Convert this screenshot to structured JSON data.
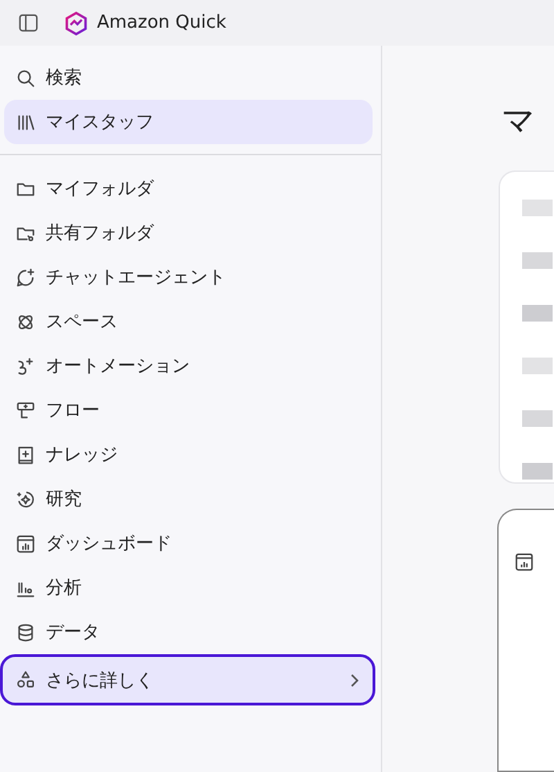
{
  "app": {
    "title": "Amazon Quick"
  },
  "sidebar": {
    "top_items": [
      {
        "label": "検索",
        "selected": false
      },
      {
        "label": "マイスタッフ",
        "selected": true
      }
    ],
    "items": [
      {
        "label": "マイフォルダ",
        "selected": false
      },
      {
        "label": "共有フォルダ",
        "selected": false
      },
      {
        "label": "チャットエージェント",
        "selected": false
      },
      {
        "label": "スペース",
        "selected": false
      },
      {
        "label": "オートメーション",
        "selected": false
      },
      {
        "label": "フロー",
        "selected": false
      },
      {
        "label": "ナレッジ",
        "selected": false
      },
      {
        "label": "研究",
        "selected": false
      },
      {
        "label": "ダッシュボード",
        "selected": false
      },
      {
        "label": "分析",
        "selected": false
      },
      {
        "label": "データ",
        "selected": false
      }
    ],
    "more": {
      "label": "さらに詳しく",
      "focused": true
    }
  },
  "main": {
    "heading": "マ"
  }
}
